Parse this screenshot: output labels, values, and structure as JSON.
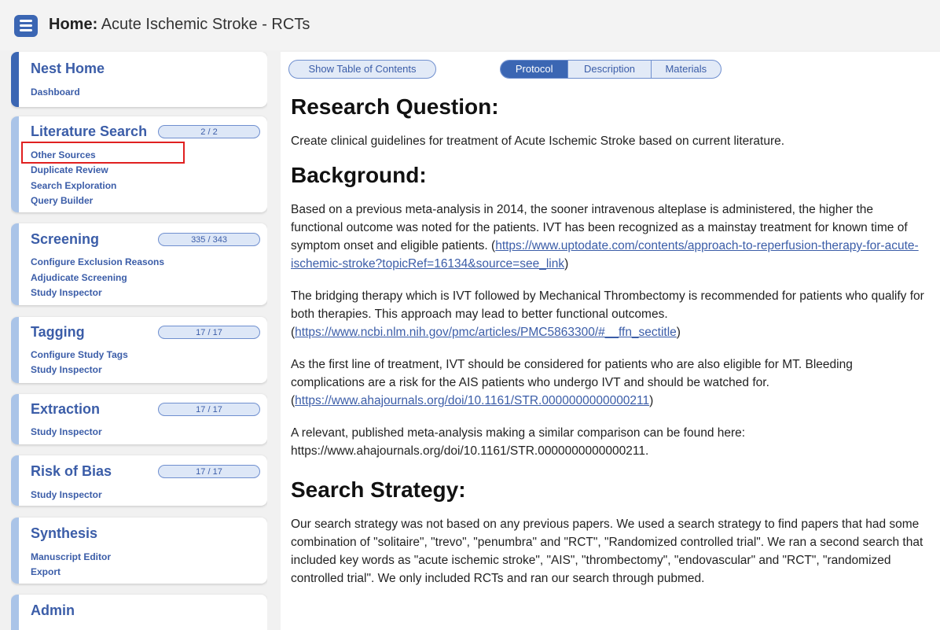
{
  "header": {
    "title_bold": "Home:",
    "title_rest": " Acute Ischemic Stroke - RCTs"
  },
  "sidebar": {
    "nest_home": {
      "title": "Nest Home",
      "links": [
        "Dashboard"
      ]
    },
    "literature_search": {
      "title": "Literature Search",
      "progress": "2 / 2",
      "links": [
        "Other Sources",
        "Duplicate Review",
        "Search Exploration",
        "Query Builder"
      ]
    },
    "screening": {
      "title": "Screening",
      "progress": "335 / 343",
      "links": [
        "Configure Exclusion Reasons",
        "Adjudicate Screening",
        "Study Inspector"
      ]
    },
    "tagging": {
      "title": "Tagging",
      "progress": "17 / 17",
      "links": [
        "Configure Study Tags",
        "Study Inspector"
      ]
    },
    "extraction": {
      "title": "Extraction",
      "progress": "17 / 17",
      "links": [
        "Study Inspector"
      ]
    },
    "risk_of_bias": {
      "title": "Risk of Bias",
      "progress": "17 / 17",
      "links": [
        "Study Inspector"
      ]
    },
    "synthesis": {
      "title": "Synthesis",
      "links": [
        "Manuscript Editor",
        "Export"
      ]
    },
    "admin": {
      "title": "Admin"
    }
  },
  "main": {
    "toc_label": "Show Table of Contents",
    "tabs": [
      "Protocol",
      "Description",
      "Materials"
    ],
    "research_question": {
      "heading": "Research Question:",
      "text": "Create clinical guidelines for treatment of Acute Ischemic Stroke based on current literature."
    },
    "background": {
      "heading": "Background:",
      "p1_text": "Based on a previous meta-analysis in 2014, the sooner intravenous alteplase is administered, the higher the functional outcome was noted for the patients. IVT has been recognized as a mainstay treatment for known time of symptom onset and eligible patients.",
      "p1_link": "https://www.uptodate.com/contents/approach-to-reperfusion-therapy-for-acute-ischemic-stroke?topicRef=16134&source=see_link",
      "p2_text": "The bridging therapy which is IVT followed by Mechanical Thrombectomy is recommended for patients who qualify for both therapies. This approach may lead to better functional outcomes.",
      "p2_link": "https://www.ncbi.nlm.nih.gov/pmc/articles/PMC5863300/#__ffn_sectitle",
      "p3_text": "As the first line of treatment, IVT should be considered for patients who are also eligible for MT. Bleeding complications are a risk for the AIS patients who undergo IVT and should be watched for.",
      "p3_link": "https://www.ahajournals.org/doi/10.1161/STR.0000000000000211",
      "p4_text": "A relevant, published meta-analysis making a similar comparison can be found here: https://www.ahajournals.org/doi/10.1161/STR.0000000000000211."
    },
    "search_strategy": {
      "heading": "Search Strategy:",
      "text": "Our search strategy was not based on any previous papers. We used a search strategy to find papers that had some combination of \"solitaire\", \"trevo\", \"penumbra\" and \"RCT\", \"Randomized controlled trial\". We ran a second search that included key words as \"acute ischemic stroke\", \"AIS\", \"thrombectomy\", \"endovascular\" and \"RCT\", \"randomized controlled trial\". We only included RCTs and ran our search through pubmed."
    }
  }
}
